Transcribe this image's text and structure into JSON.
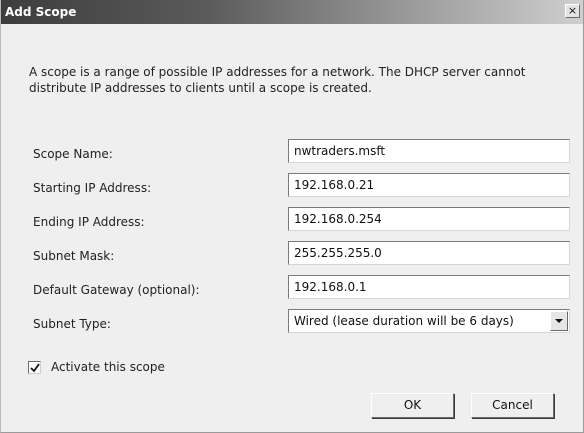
{
  "window": {
    "title": "Add Scope",
    "close_glyph": "×"
  },
  "description": "A scope is a range of possible IP addresses for a network. The DHCP server cannot distribute IP addresses to clients until a scope is created.",
  "fields": {
    "scope_name": {
      "label": "Scope Name:",
      "value": "nwtraders.msft"
    },
    "start_ip": {
      "label": "Starting IP Address:",
      "value": "192.168.0.21"
    },
    "end_ip": {
      "label": "Ending IP Address:",
      "value": "192.168.0.254"
    },
    "subnet_mask": {
      "label": "Subnet Mask:",
      "value": "255.255.255.0"
    },
    "gateway": {
      "label": "Default Gateway (optional):",
      "value": "192.168.0.1"
    },
    "subnet_type": {
      "label": "Subnet Type:",
      "value": "Wired (lease duration will be 6 days)"
    }
  },
  "activate": {
    "label": "Activate this scope",
    "checked": true
  },
  "buttons": {
    "ok": "OK",
    "cancel": "Cancel"
  }
}
